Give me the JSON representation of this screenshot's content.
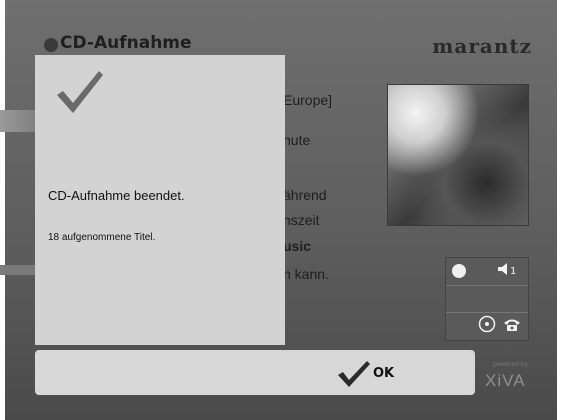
{
  "window": {
    "title": "CD-Aufnahme",
    "brand": "marantz"
  },
  "background_text": {
    "lines": [
      "Europe]",
      "nute",
      "ährend",
      "nszeit",
      "usic",
      "n kann."
    ]
  },
  "dialog": {
    "message": "CD-Aufnahme beendet.",
    "detail": "18 aufgenommene Titel."
  },
  "side_panel": {
    "volume_label": "◄",
    "volume_number": "1"
  },
  "actions": {
    "ok_label": "OK"
  },
  "footer": {
    "logo": "XiVA",
    "tagline": "powered by"
  },
  "icons": {
    "check": "check-icon",
    "record": "record-dot-icon",
    "volume": "speaker-icon",
    "disc": "disc-icon",
    "phone": "phone-icon"
  }
}
